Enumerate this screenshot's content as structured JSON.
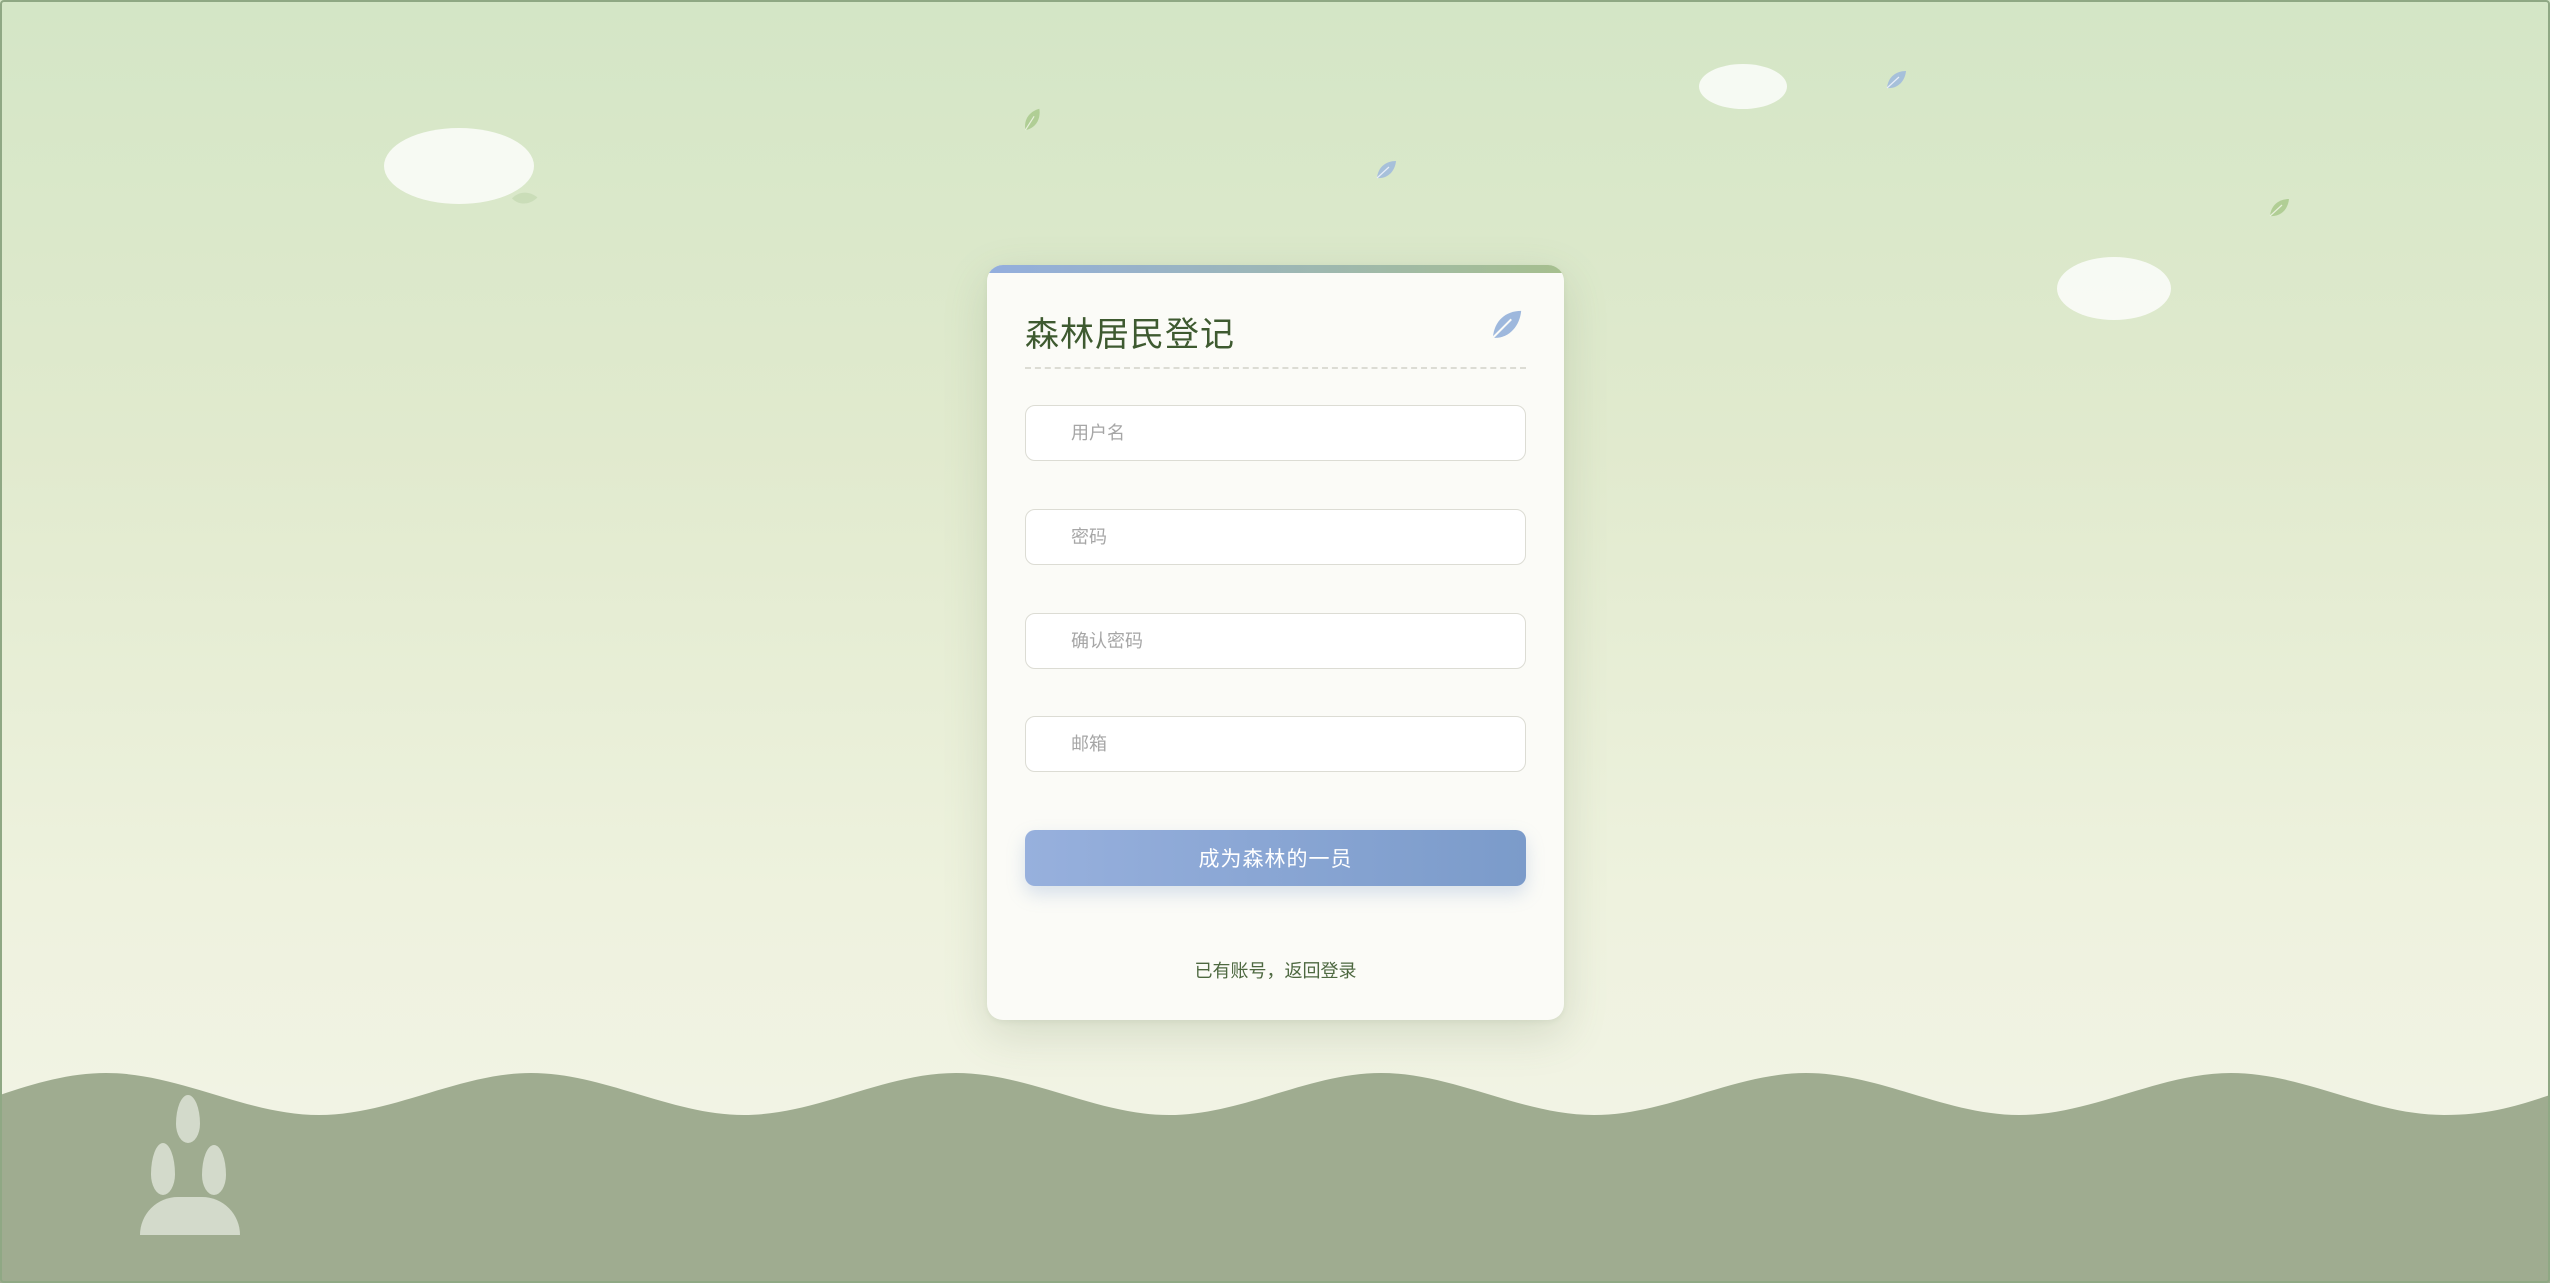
{
  "theme": {
    "accent": "#7b9bca",
    "title_color": "#3e5a30",
    "ground_color": "#9fac90",
    "leaf_green": "#a9c98c",
    "leaf_blue": "#9eb8dd"
  },
  "card": {
    "title": "森林居民登记",
    "title_icon": "leaf-icon"
  },
  "form": {
    "username_placeholder": "用户名",
    "password_placeholder": "密码",
    "confirm_password_placeholder": "确认密码",
    "email_placeholder": "邮箱",
    "submit_label": "成为森林的一员",
    "login_link": "已有账号，返回登录"
  },
  "decor": {
    "icons": [
      "cloud-icon",
      "leaf-icon",
      "rabbit-icon",
      "wave-ground"
    ]
  }
}
